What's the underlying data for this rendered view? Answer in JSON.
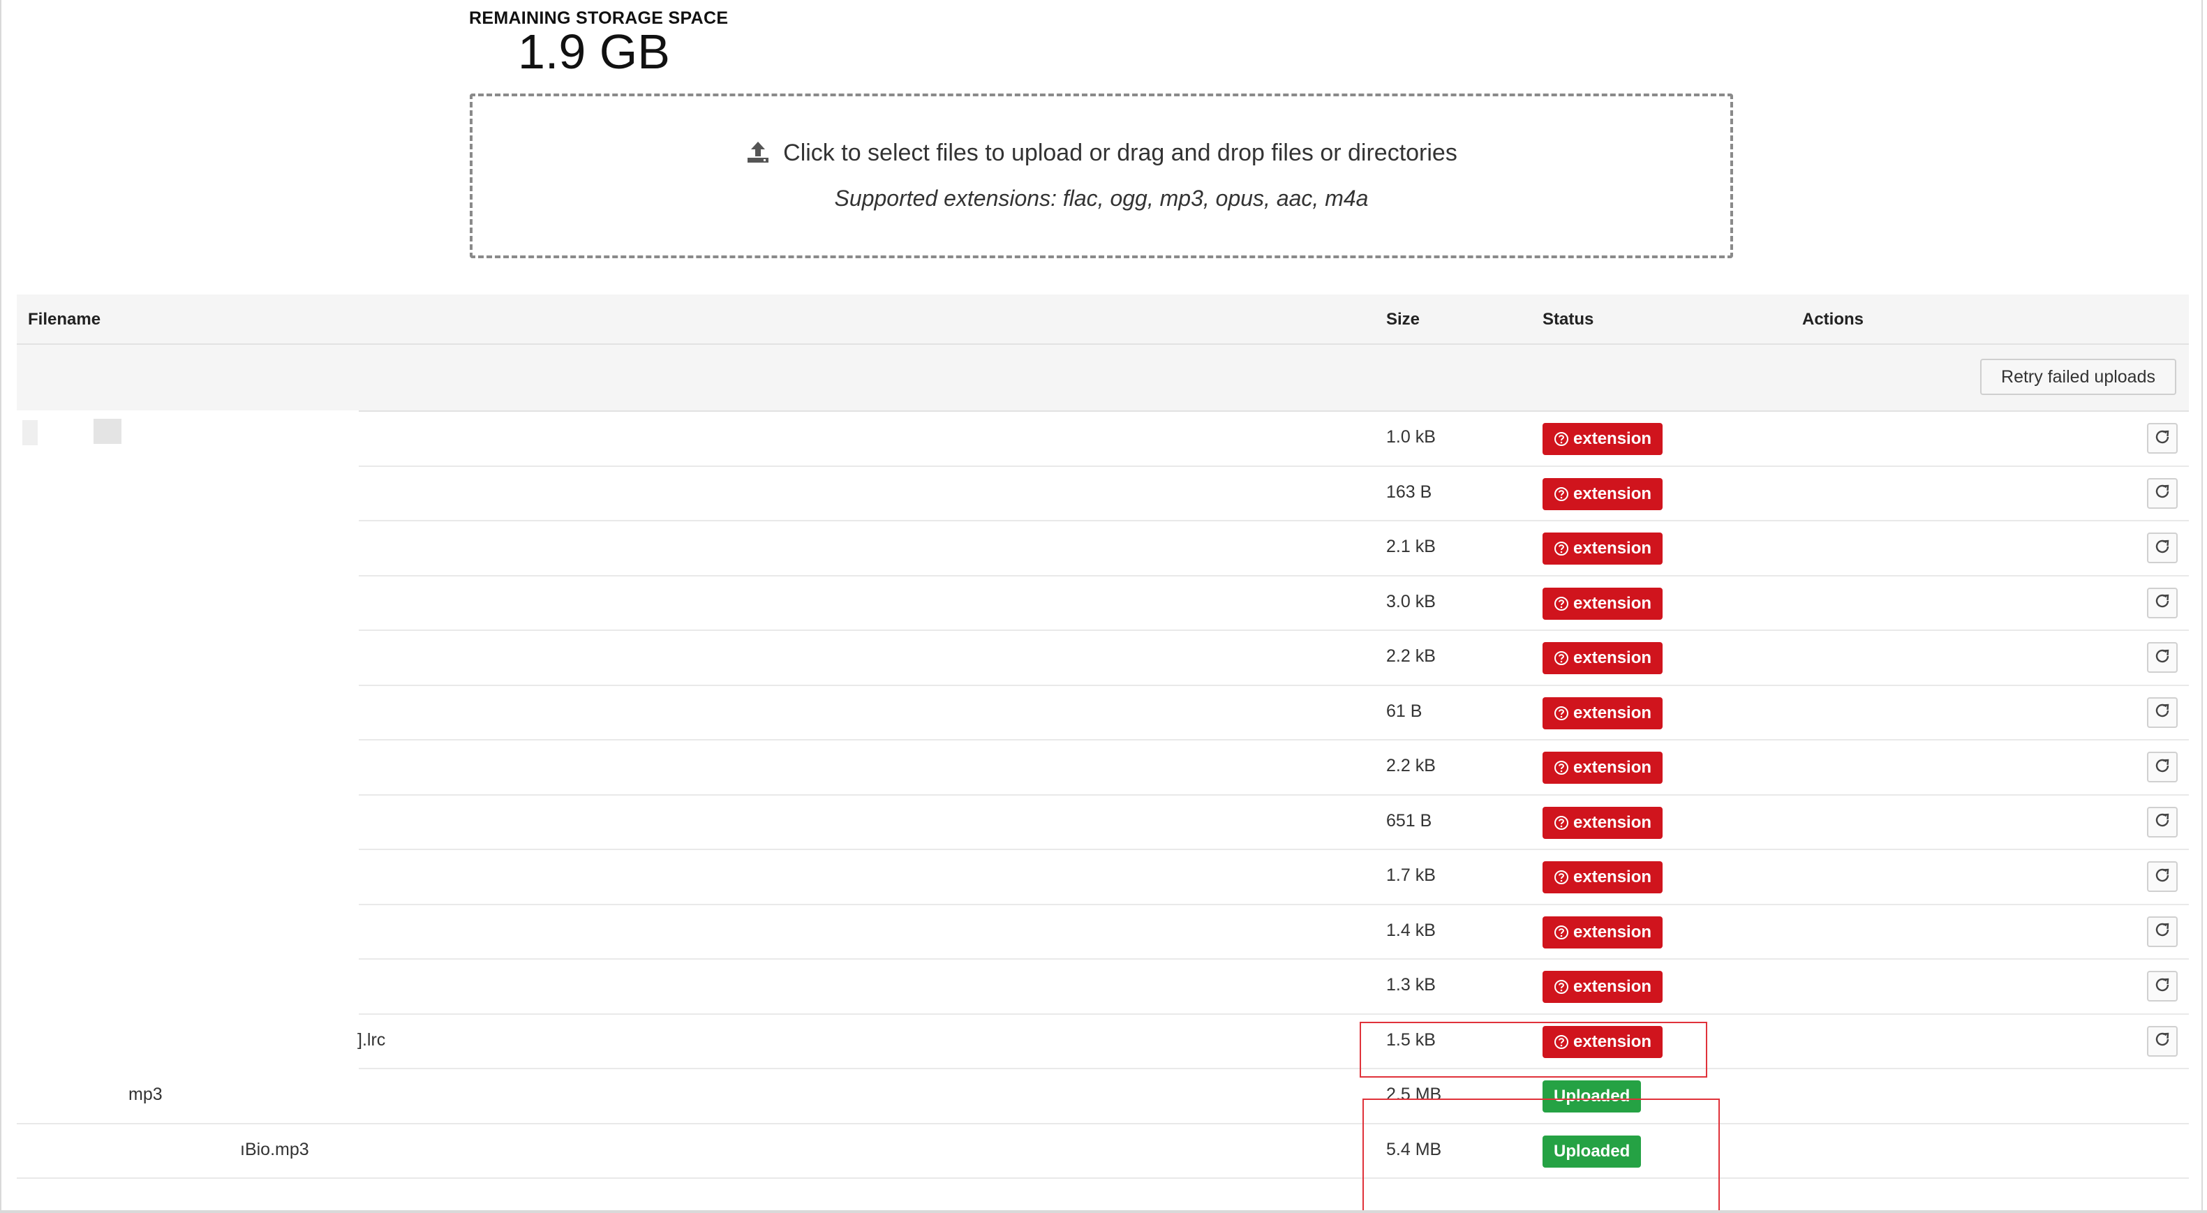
{
  "storage": {
    "label": "REMAINING STORAGE SPACE",
    "value": "1.9 GB"
  },
  "dropzone": {
    "icon": "upload-icon",
    "instruction": "Click to select files to upload or drag and drop files or directories",
    "supported": "Supported extensions: flac, ogg, mp3, opus, aac, m4a"
  },
  "table": {
    "columns": {
      "filename": "Filename",
      "size": "Size",
      "status": "Status",
      "actions": "Actions"
    },
    "retry_all_label": "Retry failed uploads",
    "rows": [
      {
        "filename": "",
        "size": "1.0 kB",
        "status": "extension",
        "state": "error"
      },
      {
        "filename": "",
        "size": "163 B",
        "status": "extension",
        "state": "error"
      },
      {
        "filename": "",
        "size": "2.1 kB",
        "status": "extension",
        "state": "error"
      },
      {
        "filename": "",
        "size": "3.0 kB",
        "status": "extension",
        "state": "error"
      },
      {
        "filename": "",
        "size": "2.2 kB",
        "status": "extension",
        "state": "error"
      },
      {
        "filename": "",
        "size": "61 B",
        "status": "extension",
        "state": "error"
      },
      {
        "filename": "",
        "size": "2.2 kB",
        "status": "extension",
        "state": "error"
      },
      {
        "filename": "",
        "size": "651 B",
        "status": "extension",
        "state": "error"
      },
      {
        "filename": "",
        "size": "1.7 kB",
        "status": "extension",
        "state": "error"
      },
      {
        "filename": "",
        "size": "1.4 kB",
        "status": "extension",
        "state": "error"
      },
      {
        "filename": "",
        "size": "1.3 kB",
        "status": "extension",
        "state": "error"
      },
      {
        "filename": "].lrc",
        "size": "1.5 kB",
        "status": "extension",
        "state": "error"
      },
      {
        "filename": "mp3",
        "size": "2.5 MB",
        "status": "Uploaded",
        "state": "success"
      },
      {
        "filename": "ıBio.mp3",
        "size": "5.4 MB",
        "status": "Uploaded",
        "state": "success"
      }
    ]
  },
  "colors": {
    "error_badge": "#d0141d",
    "success_badge": "#25a244",
    "highlight_box": "#e0323a"
  },
  "icons": {
    "status_error": "question-circle-icon",
    "row_action": "retry-icon"
  }
}
